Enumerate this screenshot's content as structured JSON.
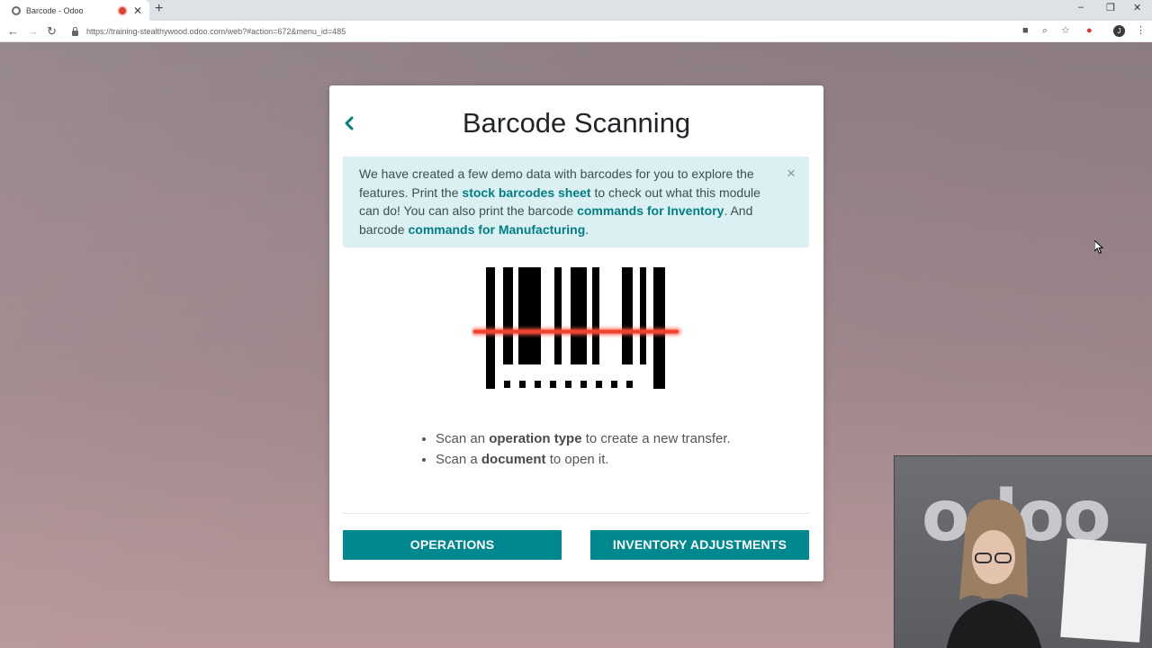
{
  "browser": {
    "tab_title": "Barcode - Odoo",
    "tab_close": "✕",
    "new_tab": "+",
    "url": "https://training-stealthywood.odoo.com/web?#action=672&menu_id=485",
    "avatar_initial": "J"
  },
  "modal": {
    "title": "Barcode Scanning",
    "alert": {
      "text_1": "We have created a few demo data with barcodes for you to explore the features. Print the ",
      "link_1": "stock barcodes sheet",
      "text_2": " to check out what this module can do! You can also print the barcode ",
      "link_2": "commands for Inventory",
      "text_3": ". And barcode ",
      "link_3": "commands for Manufacturing",
      "text_4": ".",
      "close": "×"
    },
    "instructions": [
      {
        "pre": "Scan an ",
        "bold": "operation type",
        "post": " to create a new transfer."
      },
      {
        "pre": "Scan a ",
        "bold": "document",
        "post": " to open it."
      }
    ],
    "buttons": {
      "operations": "OPERATIONS",
      "inventory_adjustments": "INVENTORY ADJUSTMENTS"
    }
  },
  "webcam": {
    "logo": "odoo"
  },
  "colors": {
    "accent": "#00888f",
    "link": "#017e84",
    "alert_bg": "#dbf0f3",
    "scan_line": "#f0402f"
  }
}
